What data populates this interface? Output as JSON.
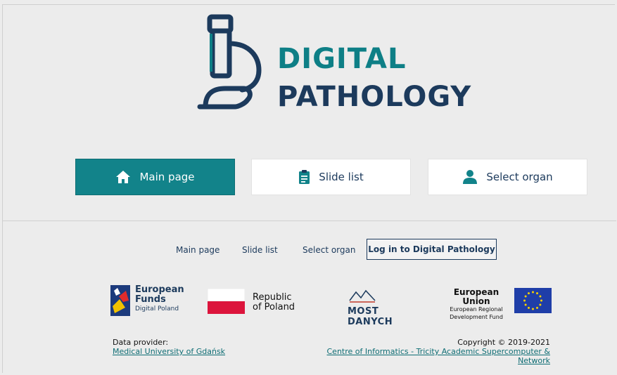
{
  "logo": {
    "line1": "DIGITAL",
    "line2": "PATHOLOGY",
    "icon": "microscope-icon"
  },
  "nav": {
    "main_page": "Main page",
    "slide_list": "Slide list",
    "select_organ": "Select organ"
  },
  "footer": {
    "links": {
      "main_page": "Main page",
      "slide_list": "Slide list",
      "select_organ": "Select organ"
    },
    "login_label": "Log in to Digital Pathology"
  },
  "sponsors": {
    "european_funds": {
      "title_line1": "European",
      "title_line2": "Funds",
      "subtitle": "Digital Poland"
    },
    "republic_of_poland": {
      "line1": "Republic",
      "line2": "of Poland"
    },
    "most_danych": {
      "label": "MOST DANYCH"
    },
    "european_union": {
      "title": "European Union",
      "line1": "European Regional",
      "line2": "Development Fund"
    }
  },
  "credits": {
    "provider_label": "Data provider:",
    "provider_link": "Medical University of Gdańsk",
    "copyright": "Copyright © 2019-2021",
    "centre_link": "Centre of Informatics - Tricity Academic Supercomputer & Network"
  },
  "colors": {
    "accent": "#12838a",
    "navy": "#1c3a5c",
    "background": "#ececec"
  }
}
